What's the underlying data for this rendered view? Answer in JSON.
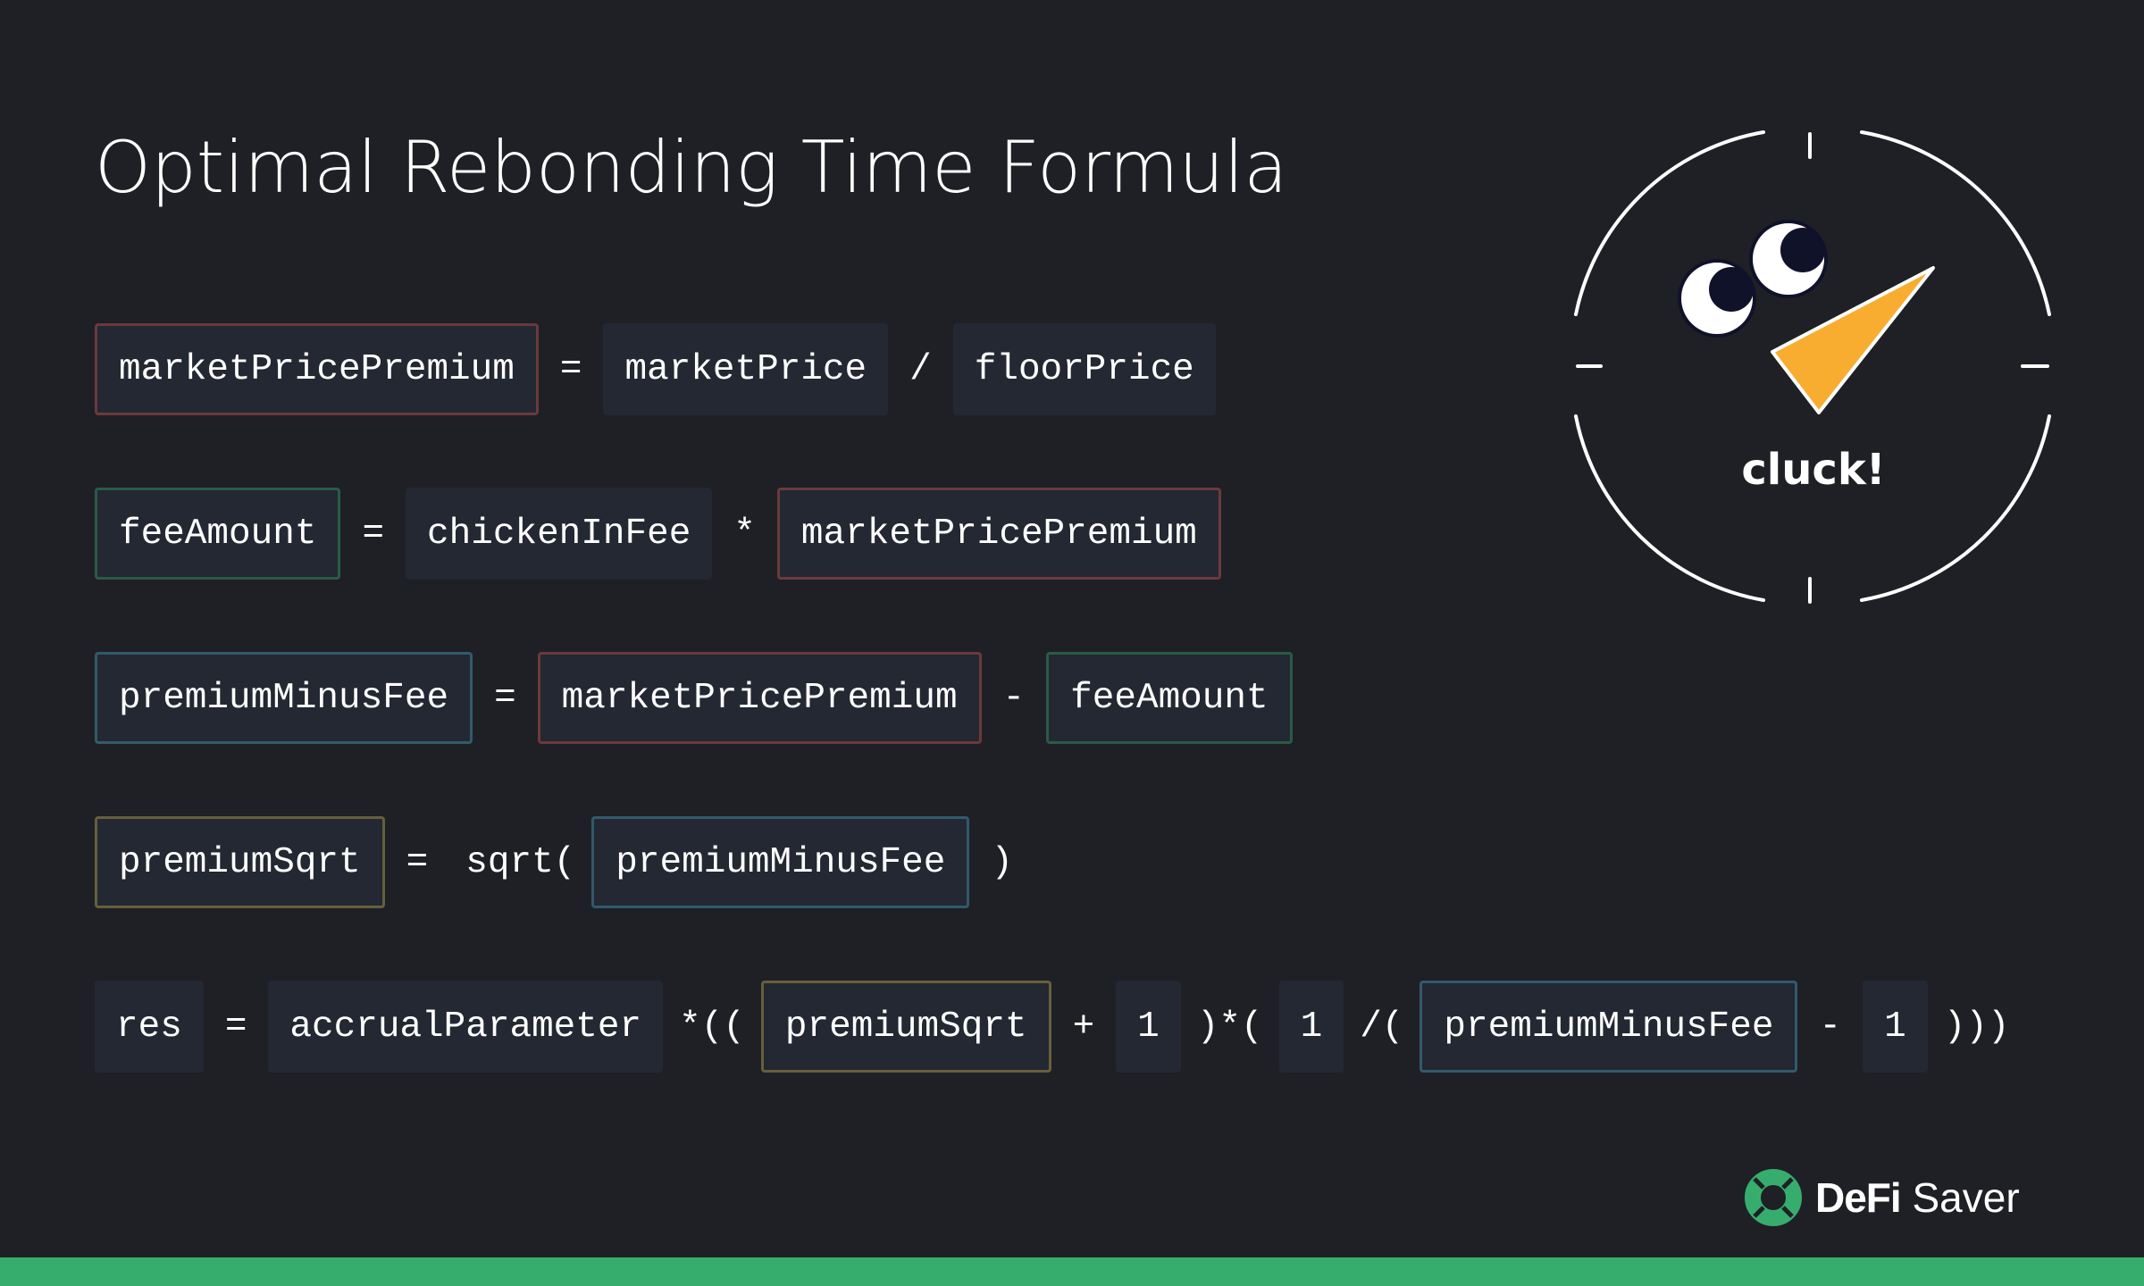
{
  "title": "Optimal Rebonding Time Formula",
  "formulas": [
    {
      "tokens": [
        {
          "text": "marketPricePremium",
          "kind": "box",
          "border": "red"
        },
        {
          "text": "=",
          "kind": "op"
        },
        {
          "text": "marketPrice",
          "kind": "box",
          "border": "none"
        },
        {
          "text": "/",
          "kind": "op"
        },
        {
          "text": "floorPrice",
          "kind": "box",
          "border": "none"
        }
      ]
    },
    {
      "tokens": [
        {
          "text": "feeAmount",
          "kind": "box",
          "border": "green"
        },
        {
          "text": "=",
          "kind": "op"
        },
        {
          "text": "chickenInFee",
          "kind": "box",
          "border": "none"
        },
        {
          "text": "*",
          "kind": "op"
        },
        {
          "text": "marketPricePremium",
          "kind": "box",
          "border": "red"
        }
      ]
    },
    {
      "tokens": [
        {
          "text": "premiumMinusFee",
          "kind": "box",
          "border": "blue"
        },
        {
          "text": "=",
          "kind": "op"
        },
        {
          "text": "marketPricePremium",
          "kind": "box",
          "border": "red"
        },
        {
          "text": "-",
          "kind": "op"
        },
        {
          "text": "feeAmount",
          "kind": "box",
          "border": "green"
        }
      ]
    },
    {
      "tokens": [
        {
          "text": "premiumSqrt",
          "kind": "box",
          "border": "yellow"
        },
        {
          "text": "=",
          "kind": "op"
        },
        {
          "text": "sqrt(",
          "kind": "op"
        },
        {
          "text": "premiumMinusFee",
          "kind": "box",
          "border": "blue"
        },
        {
          "text": ")",
          "kind": "op"
        }
      ]
    },
    {
      "tokens": [
        {
          "text": "res",
          "kind": "box",
          "border": "none"
        },
        {
          "text": "=",
          "kind": "op"
        },
        {
          "text": "accrualParameter",
          "kind": "box",
          "border": "none"
        },
        {
          "text": "*((",
          "kind": "op"
        },
        {
          "text": "premiumSqrt",
          "kind": "box",
          "border": "yellow"
        },
        {
          "text": "+",
          "kind": "op"
        },
        {
          "text": "1",
          "kind": "box",
          "border": "none"
        },
        {
          "text": ")*(",
          "kind": "op"
        },
        {
          "text": "1",
          "kind": "box",
          "border": "none"
        },
        {
          "text": "/(",
          "kind": "op"
        },
        {
          "text": "premiumMinusFee",
          "kind": "box",
          "border": "blue"
        },
        {
          "text": "-",
          "kind": "op"
        },
        {
          "text": "1",
          "kind": "box",
          "border": "none"
        },
        {
          "text": ")))",
          "kind": "op"
        }
      ]
    }
  ],
  "clock": {
    "label": "cluck!",
    "hand_color": "#f8ad31"
  },
  "brand": {
    "name_bold": "DeFi",
    "name_light": "Saver",
    "logo_icon": "lifebuoy-icon",
    "color": "#37ad6d"
  }
}
